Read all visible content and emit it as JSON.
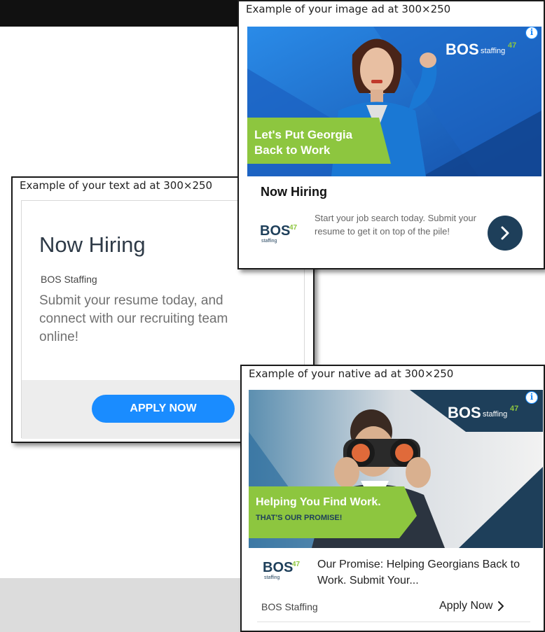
{
  "text_ad": {
    "caption": "Example of your text ad at 300×250",
    "headline": "Now Hiring",
    "advertiser": "BOS Staffing",
    "description": "Submit your resume today, and connect with our recruiting team online!",
    "cta": "APPLY NOW"
  },
  "image_ad": {
    "caption": "Example of your image ad at 300×250",
    "banner_text_line1": "Let's Put Georgia",
    "banner_text_line2": "Back to Work",
    "banner_logo": "BOS",
    "banner_logo_sub": "staffing",
    "headline": "Now Hiring",
    "description": "Start your job search today. Submit your resume to get it on top of the pile!",
    "logo": "BOS",
    "logo_sub": "staffing",
    "info_icon": "i"
  },
  "native_ad": {
    "caption": "Example of your native ad at 300×250",
    "banner_text_line1": "Helping You Find Work.",
    "banner_text_line2": "THAT'S OUR PROMISE!",
    "banner_logo": "BOS",
    "banner_logo_sub": "staffing",
    "headline": "Our Promise: Helping Georgians Back to Work. Submit Your...",
    "logo": "BOS",
    "logo_sub": "staffing",
    "advertiser": "BOS Staffing",
    "cta": "Apply Now",
    "info_icon": "i"
  },
  "colors": {
    "cta_blue": "#1a8cff",
    "brand_green": "#8dc63f",
    "brand_navy": "#1e3f5a",
    "banner_blue": "#1e6fd0"
  }
}
